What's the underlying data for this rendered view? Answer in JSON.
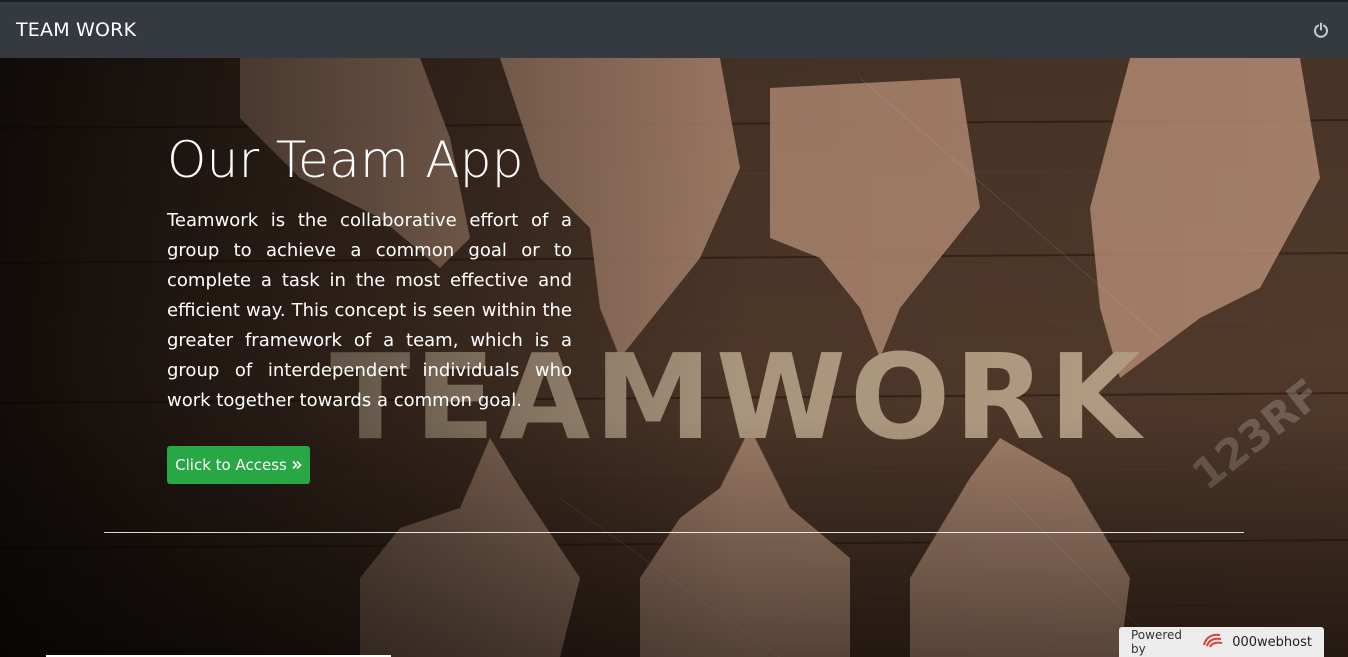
{
  "navbar": {
    "brand": "TEAM WORK",
    "power_icon": "power-icon"
  },
  "hero": {
    "title": "Our Team App",
    "description": "Teamwork is the collaborative effort of a group to achieve a common goal or to complete a task in the most effective and efficient way. This concept is seen within the greater framework of a team, which is a group of interdependent individuals who work together towards a common goal.",
    "background_word": "TEAMWORK",
    "watermark": "123RF",
    "button": {
      "label": "Click to Access",
      "icon": "double-chevron-right-icon",
      "color": "#28a745"
    }
  },
  "footer_badge": {
    "label": "Powered by",
    "name": "000webhost",
    "icon": "000webhost-logo-icon"
  },
  "colors": {
    "navbar": "#343a40",
    "button": "#28a745",
    "wood": "#4a3426"
  }
}
